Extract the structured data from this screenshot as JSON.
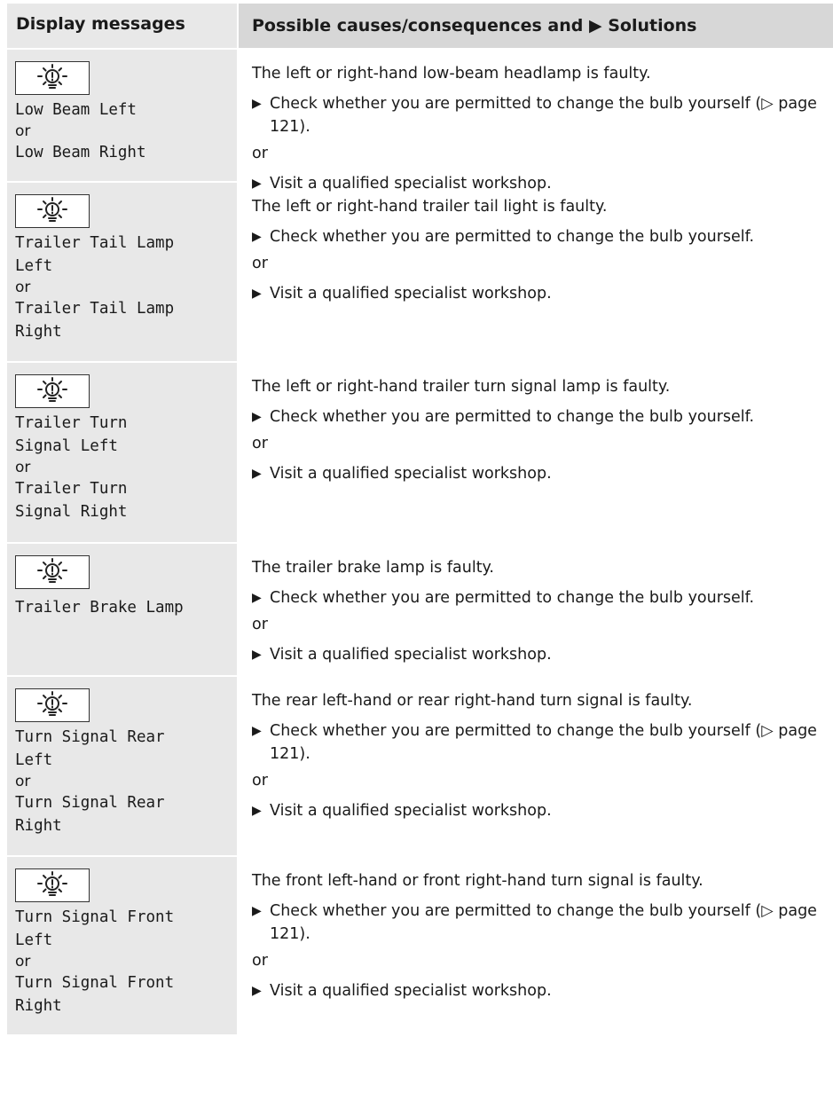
{
  "header": {
    "col1": "Display messages",
    "col2": "Possible causes/consequences and ▶ Solutions"
  },
  "or_label": "or",
  "rows": [
    {
      "msg1": "Low Beam Left",
      "msg2": "Low Beam Right",
      "desc": "The left or right-hand low-beam headlamp is faulty.",
      "step1": "Check whether you are permitted to change the bulb yourself (▷ page 121).",
      "step2": "Visit a qualified specialist workshop."
    },
    {
      "msg1": "Trailer Tail Lamp\nLeft",
      "msg2": "Trailer Tail Lamp\nRight",
      "desc": "The left or right-hand trailer tail light is faulty.",
      "step1": "Check whether you are permitted to change the bulb yourself.",
      "step2": "Visit a qualified specialist workshop."
    },
    {
      "msg1": "Trailer Turn\nSignal Left",
      "msg2": "Trailer Turn\nSignal Right",
      "desc": "The left or right-hand trailer turn signal lamp is faulty.",
      "step1": "Check whether you are permitted to change the bulb yourself.",
      "step2": "Visit a qualified specialist workshop."
    },
    {
      "msg1": "Trailer Brake Lamp",
      "desc": "The trailer brake lamp is faulty.",
      "step1": "Check whether you are permitted to change the bulb yourself.",
      "step2": "Visit a qualified specialist workshop."
    },
    {
      "msg1": "Turn Signal Rear\nLeft",
      "msg2": "Turn Signal Rear\nRight",
      "desc": "The rear left-hand or rear right-hand turn signal is faulty.",
      "step1": "Check whether you are permitted to change the bulb yourself (▷ page 121).",
      "step2": "Visit a qualified specialist workshop."
    },
    {
      "msg1": "Turn Signal Front\nLeft",
      "msg2": "Turn Signal Front\nRight",
      "desc": "The front left-hand or front right-hand turn signal is faulty.",
      "step1": "Check whether you are permitted to change the bulb yourself (▷ page 121).",
      "step2": "Visit a qualified specialist workshop."
    }
  ],
  "icon": "bulb-failure-icon",
  "colors": {
    "header_bg": "#d7d7d7",
    "left_col_bg": "#e8e8e8"
  }
}
